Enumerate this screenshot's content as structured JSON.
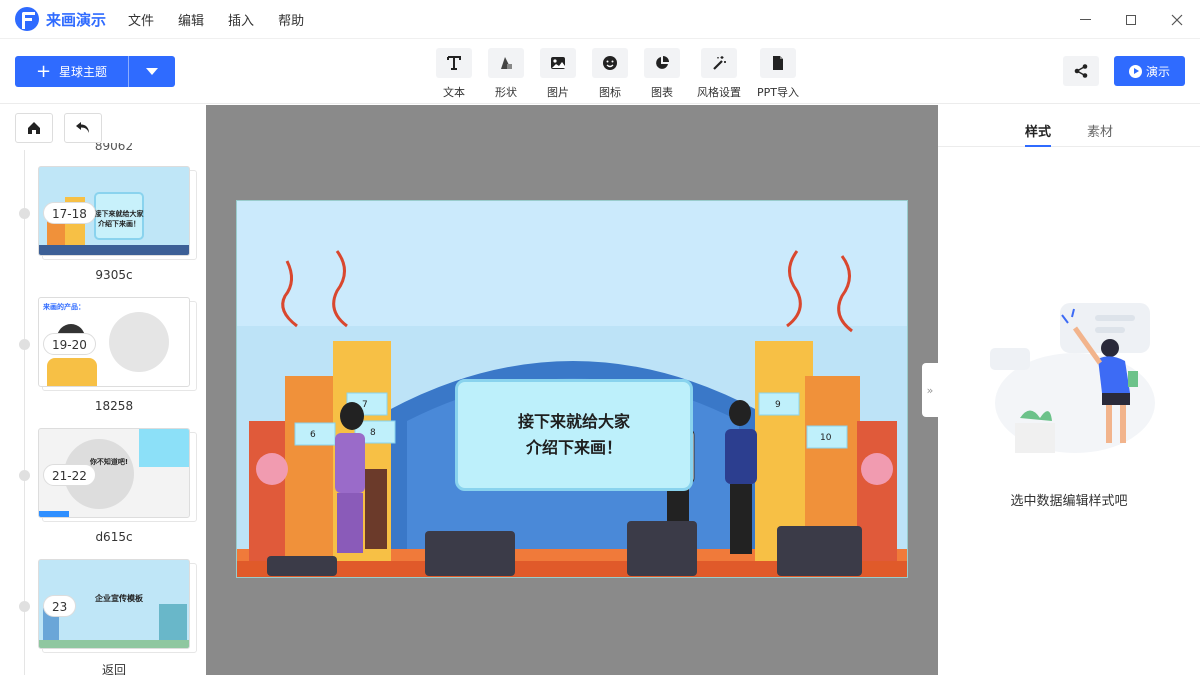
{
  "app": {
    "name": "来画演示"
  },
  "menu": [
    "文件",
    "编辑",
    "插入",
    "帮助"
  ],
  "toolbar": {
    "theme_label": "星球主题",
    "tools": [
      {
        "label": "文本",
        "icon": "text-icon"
      },
      {
        "label": "形状",
        "icon": "shape-icon"
      },
      {
        "label": "图片",
        "icon": "image-icon"
      },
      {
        "label": "图标",
        "icon": "emoji-icon"
      },
      {
        "label": "图表",
        "icon": "pie-chart-icon"
      },
      {
        "label": "风格设置",
        "icon": "magic-wand-icon"
      },
      {
        "label": "PPT导入",
        "icon": "file-icon"
      }
    ],
    "present_label": "演示"
  },
  "sidebar": {
    "cut_top_label": "89062",
    "slides": [
      {
        "range": "17-18",
        "name": "9305c",
        "thumb_text": "接下来就给大家\n介绍下来画！"
      },
      {
        "range": "19-20",
        "name": "18258",
        "thumb_text": "来画的产品："
      },
      {
        "range": "21-22",
        "name": "d615c",
        "thumb_text": "你不知道吧!"
      },
      {
        "range": "23",
        "name": "返回",
        "thumb_text": "企业宣传模板"
      }
    ]
  },
  "slide": {
    "title_line1": "接下来就给大家",
    "title_line2": "介绍下来画！",
    "sign_numbers": [
      "6",
      "7",
      "8",
      "9",
      "10"
    ]
  },
  "right_panel": {
    "tabs": [
      "样式",
      "素材"
    ],
    "active_tab": "样式",
    "empty_hint": "选中数据编辑样式吧"
  },
  "colors": {
    "accent": "#2f6bff",
    "canvas_bg": "#8a8a8a"
  }
}
